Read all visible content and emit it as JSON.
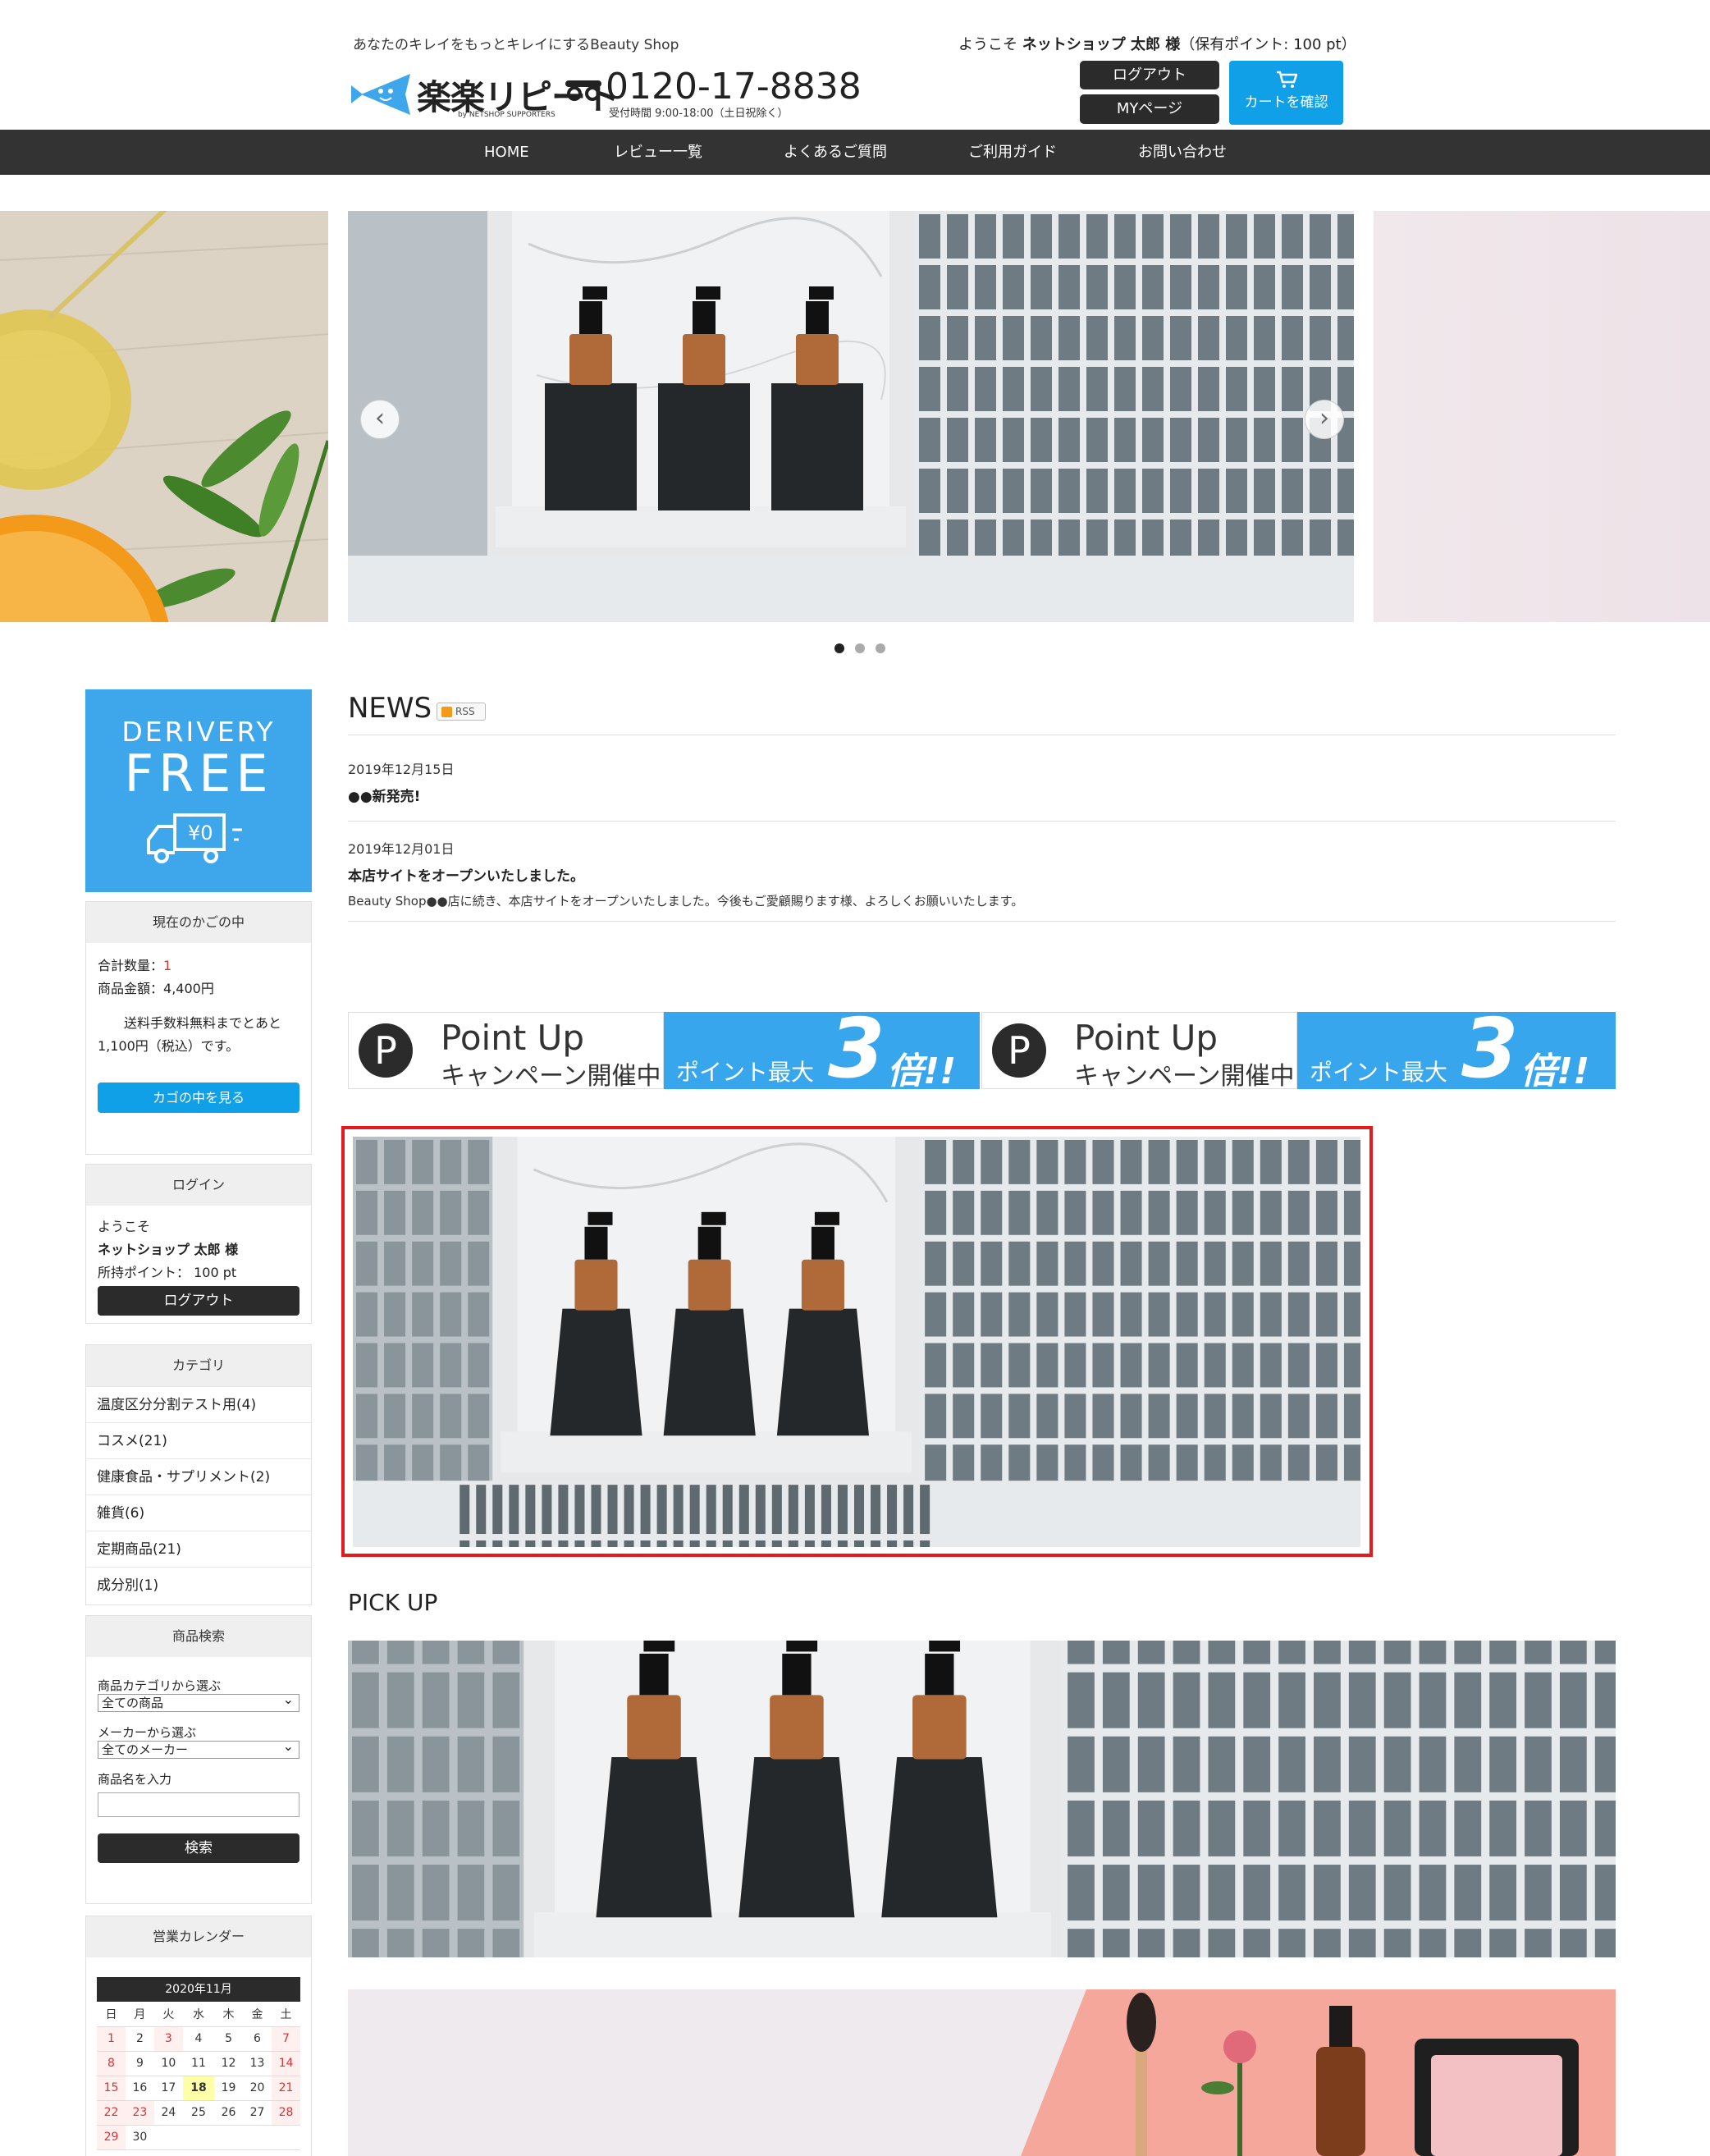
{
  "header": {
    "tagline": "あなたのキレイをもっとキレイにするBeauty Shop",
    "logo_text": "楽楽リピート",
    "logo_sub": "by NETSHOP SUPPORTERS",
    "phone": "0120-17-8838",
    "hours": "受付時間 9:00-18:00（土日祝除く）",
    "welcome_prefix": "ようこそ",
    "welcome_name": "ネットショップ 太郎 様",
    "welcome_points": "（保有ポイント: 100 pt）",
    "logout_label": "ログアウト",
    "mypage_label": "MYページ",
    "cart_label": "カートを確認"
  },
  "nav": [
    "HOME",
    "レビュー一覧",
    "よくあるご質問",
    "ご利用ガイド",
    "お問い合わせ"
  ],
  "slider": {
    "prev": "‹",
    "next": "›",
    "dots": 3,
    "active_dot": 0
  },
  "sidebar": {
    "delivery": {
      "line1": "DERIVERY",
      "line2": "FREE",
      "amount": "¥0"
    },
    "cart": {
      "title": "現在のかごの中",
      "qty_label": "合計数量：",
      "qty_value": "1",
      "amount_label": "商品金額：",
      "amount_value": "4,400円",
      "free_note": "送料手数料無料までとあと1,100円（税込）です。",
      "view_button": "カゴの中を見る"
    },
    "login": {
      "title": "ログイン",
      "welcome": "ようこそ",
      "name": "ネットショップ 太郎 様",
      "points": "所持ポイント： 100 pt",
      "logout_button": "ログアウト"
    },
    "category": {
      "title": "カテゴリ",
      "items": [
        "温度区分分割テスト用(4)",
        "コスメ(21)",
        "健康食品・サプリメント(2)",
        "雑貨(6)",
        "定期商品(21)",
        "成分別(1)"
      ]
    },
    "search": {
      "title": "商品検索",
      "cat_label": "商品カテゴリから選ぶ",
      "cat_value": "全ての商品",
      "maker_label": "メーカーから選ぶ",
      "maker_value": "全てのメーカー",
      "name_label": "商品名を入力",
      "name_value": "",
      "button": "検索"
    },
    "calendar": {
      "title": "営業カレンダー",
      "month": "2020年11月",
      "weekdays": [
        "日",
        "月",
        "火",
        "水",
        "木",
        "金",
        "土"
      ],
      "weeks": [
        [
          "1",
          "2",
          "3",
          "4",
          "5",
          "6",
          "7"
        ],
        [
          "8",
          "9",
          "10",
          "11",
          "12",
          "13",
          "14"
        ],
        [
          "15",
          "16",
          "17",
          "18",
          "19",
          "20",
          "21"
        ],
        [
          "22",
          "23",
          "24",
          "25",
          "26",
          "27",
          "28"
        ],
        [
          "29",
          "30",
          "",
          "",
          "",
          "",
          ""
        ]
      ],
      "holidays": [
        "1",
        "3",
        "7",
        "8",
        "14",
        "15",
        "21",
        "22",
        "23",
        "28",
        "29"
      ],
      "today": "18"
    }
  },
  "news": {
    "title": "NEWS",
    "rss": "RSS",
    "items": [
      {
        "date": "2019年12月15日",
        "headline": "●●新発売!",
        "body": ""
      },
      {
        "date": "2019年12月01日",
        "headline": "本店サイトをオープンいたしました。",
        "body": "Beauty Shop●●店に続き、本店サイトをオープンいたしました。今後もご愛顧賜ります様、よろしくお願いいたします。"
      }
    ]
  },
  "banner": {
    "p": "P",
    "line1": "Point Up",
    "line2": "キャンペーン開催中",
    "right1": "ポイント最大",
    "right2": "3",
    "right3": "倍!!"
  },
  "pickup": {
    "title": "PICK UP"
  },
  "colors": {
    "accent": "#0fa0e8",
    "dark": "#2b2b2b",
    "highlight": "#e21c1c",
    "banner_blue": "#38a6ec"
  }
}
